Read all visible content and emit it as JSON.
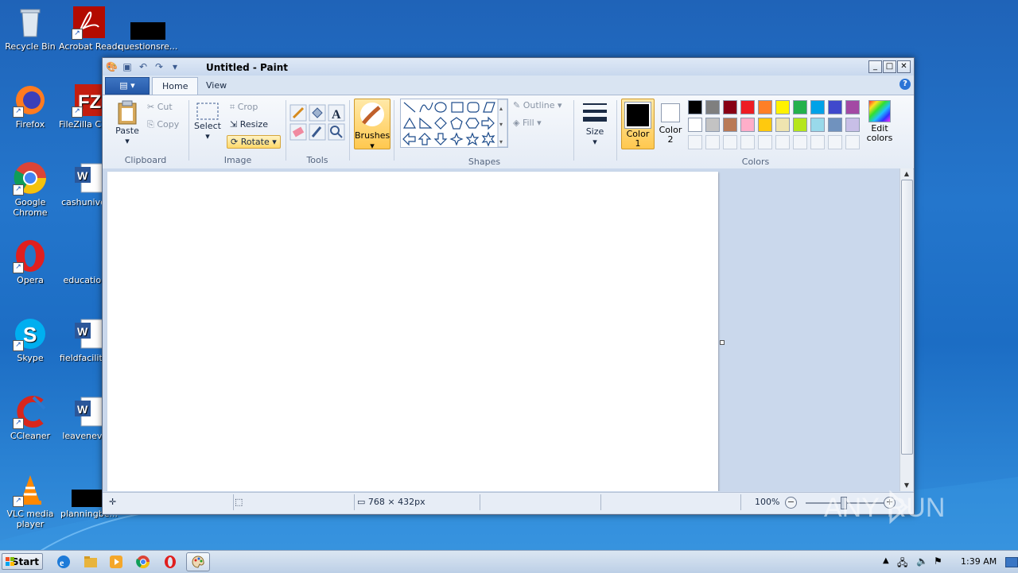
{
  "desktop": {
    "icons": [
      {
        "label": "Recycle Bin"
      },
      {
        "label": "Acrobat Reader DC"
      },
      {
        "label": "questionsre..."
      },
      {
        "label": "Firefox"
      },
      {
        "label": "FileZilla Client"
      },
      {
        "label": "Google Chrome"
      },
      {
        "label": "cashuniver..."
      },
      {
        "label": "Opera"
      },
      {
        "label": "education..."
      },
      {
        "label": "Skype"
      },
      {
        "label": "fieldfacilitie..."
      },
      {
        "label": "CCleaner"
      },
      {
        "label": "leaveneve..."
      },
      {
        "label": "VLC media player"
      },
      {
        "label": "planningbe..."
      }
    ]
  },
  "window": {
    "title": "Untitled - Paint",
    "controls": {
      "minimize": "_",
      "maximize": "□",
      "close": "✕"
    }
  },
  "ribbon": {
    "tabs": [
      {
        "label": "Home"
      },
      {
        "label": "View"
      }
    ],
    "clipboard": {
      "group_label": "Clipboard",
      "paste": "Paste",
      "cut": "Cut",
      "copy": "Copy"
    },
    "image": {
      "group_label": "Image",
      "select": "Select",
      "crop": "Crop",
      "resize": "Resize",
      "rotate": "Rotate"
    },
    "tools": {
      "group_label": "Tools"
    },
    "brushes": {
      "label": "Brushes"
    },
    "shapes": {
      "group_label": "Shapes",
      "outline": "Outline",
      "fill": "Fill"
    },
    "size": {
      "label": "Size"
    },
    "colors": {
      "group_label": "Colors",
      "color1": "Color 1",
      "color2": "Color 2",
      "edit": "Edit colors",
      "palette_row1": [
        "#000000",
        "#7f7f7f",
        "#880015",
        "#ed1c24",
        "#ff7f27",
        "#fff200",
        "#22b14c",
        "#00a2e8",
        "#3f48cc",
        "#a349a4"
      ],
      "palette_row2": [
        "#ffffff",
        "#c3c3c3",
        "#b97a57",
        "#ffaec9",
        "#ffc90e",
        "#efe4b0",
        "#b5e61d",
        "#99d9ea",
        "#7092be",
        "#c8bfe7"
      ]
    }
  },
  "statusbar": {
    "dimensions": "768 × 432px",
    "zoom": "100%"
  },
  "taskbar": {
    "start": "Start",
    "clock": "1:39 AM"
  },
  "watermark": {
    "text": "ANY RUN"
  }
}
